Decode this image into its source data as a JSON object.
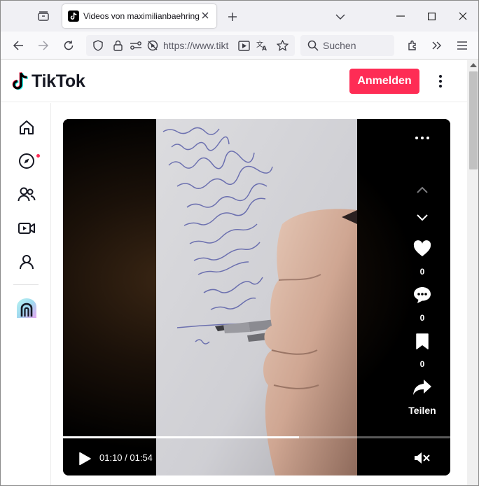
{
  "browser": {
    "tab": {
      "title": "Videos von maximilianbaehring"
    },
    "url": "https://www.tikt",
    "search_placeholder": "Suchen"
  },
  "colors": {
    "brand": "#fe2c55",
    "tab_bg": "#f0f0f4",
    "header_text": "#161823"
  },
  "tiktok": {
    "logo_text": "TikTok",
    "login_label": "Anmelden",
    "sidebar_icons": [
      "home-icon",
      "explore-icon",
      "following-icon",
      "live-icon",
      "profile-icon",
      "app-promo-icon"
    ]
  },
  "video": {
    "likes": "0",
    "comments": "0",
    "saves": "0",
    "share_label": "Teilen",
    "time": "01:10 / 01:54",
    "progress_fraction": 0.61
  }
}
